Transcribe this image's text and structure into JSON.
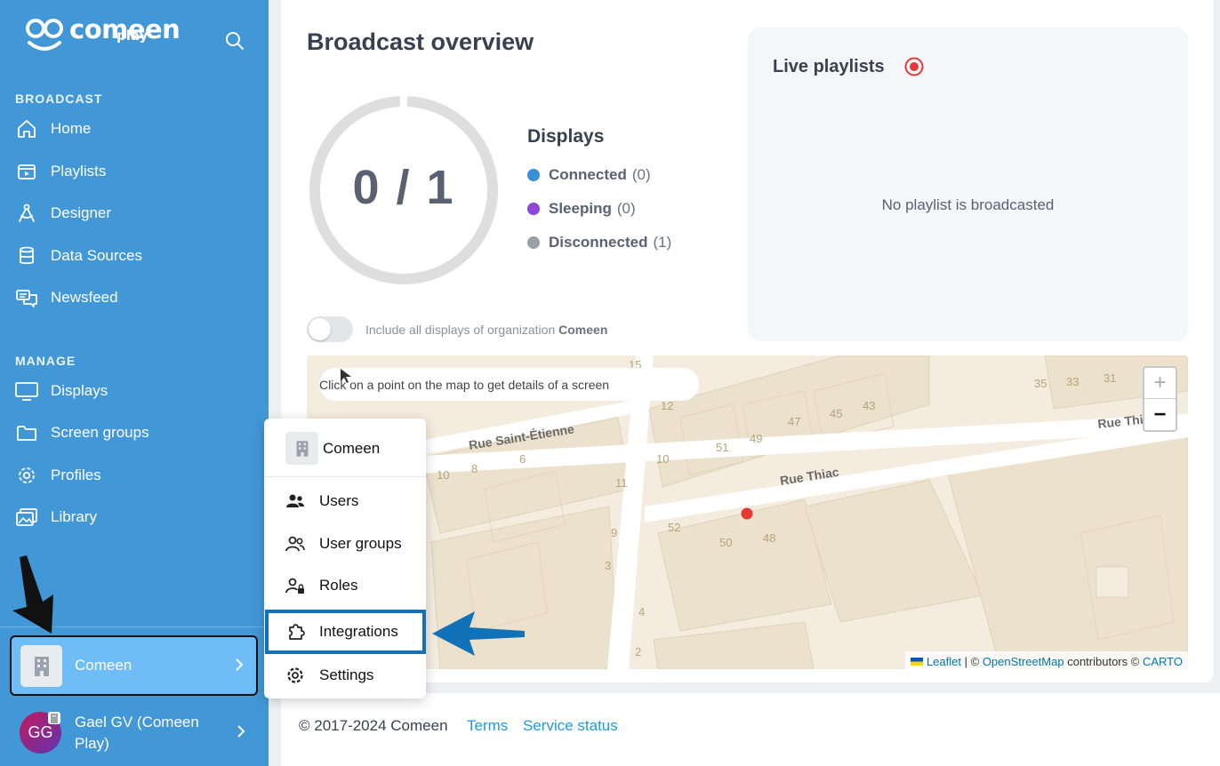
{
  "brand": {
    "word": "comeen",
    "sub": "play",
    "color": "#4297d6"
  },
  "sidebar": {
    "sections": [
      {
        "label": "BROADCAST",
        "items": [
          {
            "label": "Home",
            "icon": "home-icon"
          },
          {
            "label": "Playlists",
            "icon": "playlist-icon"
          },
          {
            "label": "Designer",
            "icon": "designer-icon"
          },
          {
            "label": "Data Sources",
            "icon": "database-icon"
          },
          {
            "label": "Newsfeed",
            "icon": "newsfeed-icon"
          }
        ]
      },
      {
        "label": "MANAGE",
        "items": [
          {
            "label": "Displays",
            "icon": "monitor-icon"
          },
          {
            "label": "Screen groups",
            "icon": "folder-icon"
          },
          {
            "label": "Profiles",
            "icon": "gear-icon"
          },
          {
            "label": "Library",
            "icon": "image-library-icon"
          }
        ]
      }
    ],
    "org": {
      "name": "Comeen"
    },
    "user": {
      "initials": "GG",
      "name": "Gael GV (Comeen Play)"
    }
  },
  "main": {
    "title": "Broadcast overview",
    "ring_text": "0 / 1",
    "connected_fraction": 0,
    "displays": {
      "title": "Displays",
      "legend": [
        {
          "name": "Connected",
          "count": "(0)",
          "color": "#3b8fd3"
        },
        {
          "name": "Sleeping",
          "count": "(0)",
          "color": "#8e44d6"
        },
        {
          "name": "Disconnected",
          "count": "(1)",
          "color": "#9aa0a8"
        }
      ]
    },
    "toggle": {
      "label": "Include all displays of organization",
      "org": "Comeen",
      "on": false
    },
    "live": {
      "title": "Live playlists",
      "empty": "No playlist is broadcasted",
      "accent": "#e53935"
    }
  },
  "map": {
    "hint": "Click on a point on the map to get details of a screen",
    "zoom_in": "+",
    "zoom_out": "−",
    "streets": [
      "Rue Saint-Étienne",
      "Rue Thiac",
      "Rue Thi"
    ],
    "house_numbers": [
      "15",
      "12",
      "10",
      "8",
      "6",
      "11",
      "9",
      "3",
      "4",
      "2",
      "51",
      "49",
      "47",
      "45",
      "43",
      "35",
      "33",
      "31",
      "52",
      "50",
      "48",
      "10"
    ],
    "attribution": {
      "leaflet": "Leaflet",
      "sep": "| ©",
      "osm": "OpenStreetMap",
      "mid": "contributors ©",
      "carto": "CARTO"
    }
  },
  "menu": {
    "org": "Comeen",
    "items": [
      {
        "label": "Users",
        "icon": "users-icon"
      },
      {
        "label": "User groups",
        "icon": "user-groups-icon"
      },
      {
        "label": "Roles",
        "icon": "user-lock-icon"
      },
      {
        "label": "Integrations",
        "icon": "puzzle-icon",
        "highlighted": true
      },
      {
        "label": "Settings",
        "icon": "gear-icon"
      }
    ]
  },
  "footer": {
    "copyright": "© 2017-2024 Comeen",
    "terms": "Terms",
    "status": "Service status"
  }
}
